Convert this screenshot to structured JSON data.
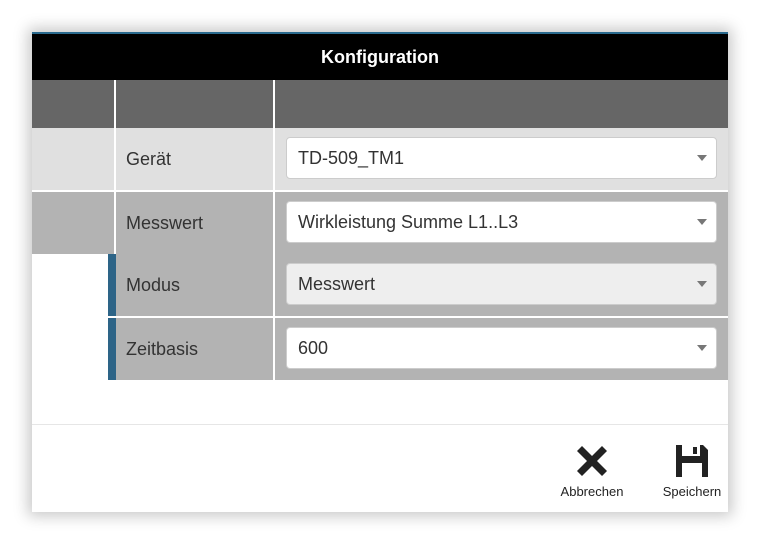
{
  "dialog": {
    "title": "Konfiguration"
  },
  "fields": [
    {
      "label": "Gerät",
      "value": "TD-509_TM1"
    },
    {
      "label": "Messwert",
      "value": "Wirkleistung Summe L1..L3"
    },
    {
      "label": "Modus",
      "value": "Messwert"
    },
    {
      "label": "Zeitbasis",
      "value": "600"
    }
  ],
  "footer": {
    "cancel_label": "Abbrechen",
    "save_label": "Speichern"
  },
  "colors": {
    "title_bar": "#000000",
    "header_row": "#666666",
    "accent_indicator": "#2d6487"
  },
  "icons": {
    "cancel": "close-icon",
    "save": "floppy-disk-icon"
  }
}
